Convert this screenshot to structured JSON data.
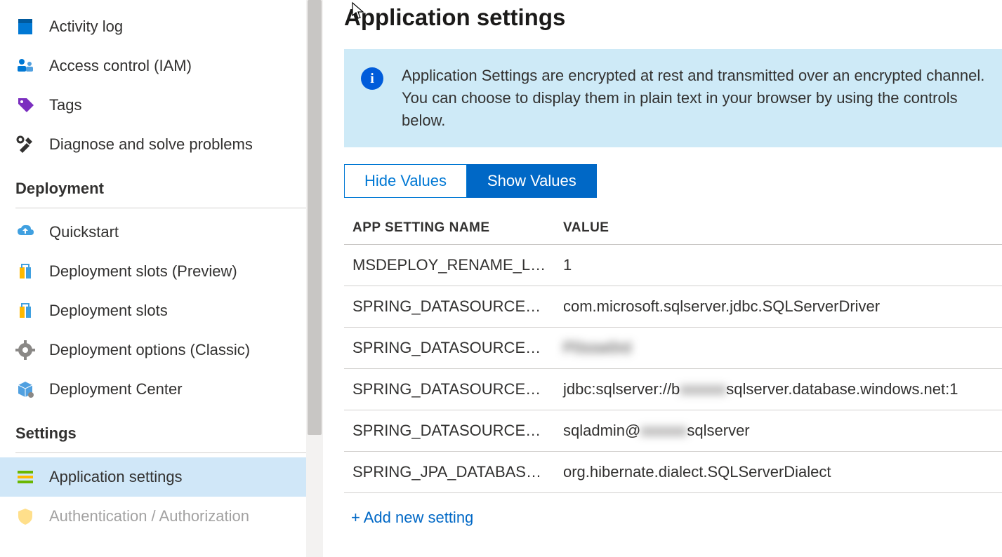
{
  "sidebar": {
    "top_items": [
      {
        "label": "Activity log",
        "name": "sidebar-item-activity-log",
        "icon": "log"
      },
      {
        "label": "Access control (IAM)",
        "name": "sidebar-item-access-control",
        "icon": "iam"
      },
      {
        "label": "Tags",
        "name": "sidebar-item-tags",
        "icon": "tag"
      },
      {
        "label": "Diagnose and solve problems",
        "name": "sidebar-item-diagnose",
        "icon": "tools"
      }
    ],
    "sections": [
      {
        "title": "Deployment",
        "items": [
          {
            "label": "Quickstart",
            "name": "sidebar-item-quickstart",
            "icon": "cloud"
          },
          {
            "label": "Deployment slots (Preview)",
            "name": "sidebar-item-deployment-slots-preview",
            "icon": "slots"
          },
          {
            "label": "Deployment slots",
            "name": "sidebar-item-deployment-slots",
            "icon": "slots"
          },
          {
            "label": "Deployment options (Classic)",
            "name": "sidebar-item-deployment-options",
            "icon": "gear"
          },
          {
            "label": "Deployment Center",
            "name": "sidebar-item-deployment-center",
            "icon": "box"
          }
        ]
      },
      {
        "title": "Settings",
        "items": [
          {
            "label": "Application settings",
            "name": "sidebar-item-application-settings",
            "icon": "appsettings",
            "selected": true
          },
          {
            "label": "Authentication / Authorization",
            "name": "sidebar-item-auth",
            "icon": "auth",
            "faded": true
          }
        ]
      }
    ]
  },
  "main": {
    "title": "Application settings",
    "banner": "Application Settings are encrypted at rest and transmitted over an encrypted channel. You can choose to display them in plain text in your browser by using the controls below.",
    "hide_btn": "Hide Values",
    "show_btn": "Show Values",
    "columns": {
      "name": "APP SETTING NAME",
      "value": "VALUE"
    },
    "rows": [
      {
        "name": "MSDEPLOY_RENAME_LOC…",
        "value": "1"
      },
      {
        "name": "SPRING_DATASOURCE_DRI…",
        "value": "com.microsoft.sqlserver.jdbc.SQLServerDriver"
      },
      {
        "name": "SPRING_DATASOURCE_PA…",
        "value_blurred": "P0ssw0rd"
      },
      {
        "name": "SPRING_DATASOURCE_URL",
        "value_prefix": "jdbc:sqlserver://b",
        "value_blurred": "xxxxxx",
        "value_suffix": "sqlserver.database.windows.net:1"
      },
      {
        "name": "SPRING_DATASOURCE_US…",
        "value_prefix": "sqladmin@",
        "value_blurred": "xxxxxx",
        "value_suffix": "sqlserver"
      },
      {
        "name": "SPRING_JPA_DATABASE_PL…",
        "value": "org.hibernate.dialect.SQLServerDialect"
      }
    ],
    "add_link": "+ Add new setting"
  }
}
